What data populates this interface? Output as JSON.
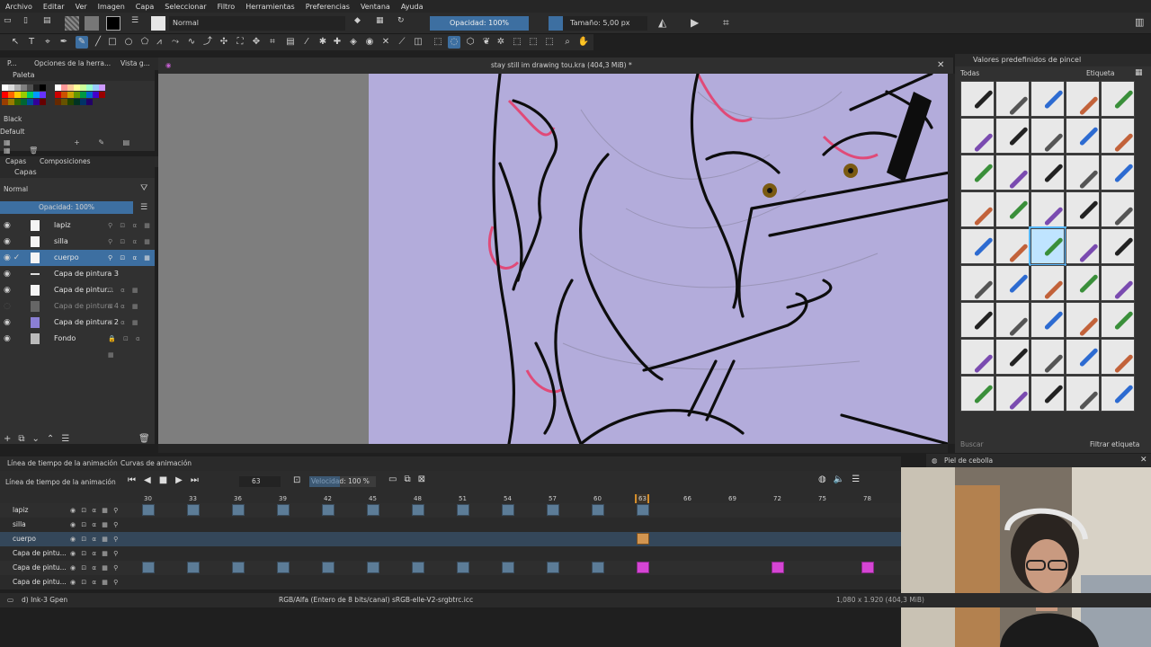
{
  "menu": [
    "Archivo",
    "Editar",
    "Ver",
    "Imagen",
    "Capa",
    "Seleccionar",
    "Filtro",
    "Herramientas",
    "Preferencias",
    "Ventana",
    "Ayuda"
  ],
  "tool_options": {
    "blend_mode": "Normal",
    "opacity": "Opacidad: 100%",
    "size": "Tamaño: 5,00 px"
  },
  "left_tabs": [
    "P...",
    "Opciones de la herra...",
    "Vista g..."
  ],
  "palette": {
    "title": "Paleta",
    "current_color": "Black",
    "preset": "Default",
    "colors": [
      "#ffffff",
      "#dcdcdc",
      "#b0b0b0",
      "#808080",
      "#505050",
      "#202020",
      "#000000",
      "#ffffff",
      "#ff9999",
      "#ffcc99",
      "#ffff99",
      "#ccff99",
      "#99ffcc",
      "#99ccff",
      "#cc99ff",
      "#ff0000",
      "#ff6600",
      "#ffcc00",
      "#99cc00",
      "#00cc66",
      "#0099ff",
      "#6633ff",
      "#cc0000",
      "#cc5200",
      "#cca300",
      "#669900",
      "#009944",
      "#0066cc",
      "#4400cc",
      "#990000",
      "#993d00",
      "#997a00",
      "#336600",
      "#006633",
      "#004c99",
      "#330099",
      "#660000",
      "#662900",
      "#665200",
      "#224400",
      "#003322",
      "#003366",
      "#220066"
    ]
  },
  "layers_panel": {
    "tabs": [
      "Capas",
      "Composiciones"
    ],
    "title": "Capas",
    "blend_mode": "Normal",
    "opacity": "Opacidad: 100%",
    "layers": [
      {
        "name": "lapiz",
        "dim": false
      },
      {
        "name": "silla",
        "dim": false
      },
      {
        "name": "cuerpo",
        "dim": false
      },
      {
        "name": "Capa de pintura 3",
        "dim": false
      },
      {
        "name": "Capa de pintur...",
        "dim": false
      },
      {
        "name": "Capa de pintura 4",
        "dim": true
      },
      {
        "name": "Capa de pintura 2",
        "dim": false
      },
      {
        "name": "Fondo",
        "dim": false
      }
    ]
  },
  "document": {
    "title": "stay still im drawing tou.kra (404,3 MiB) *"
  },
  "brush_presets": {
    "title": "Valores predefinidos de pincel",
    "filter_all": "Todas",
    "tag_label": "Etiqueta",
    "search_placeholder": "Buscar",
    "filter_tag": "Filtrar etiqueta"
  },
  "timeline": {
    "tabs": [
      "Línea de tiempo de la animación",
      "Curvas de animación"
    ],
    "title": "Línea de tiempo de la animación",
    "current_frame": "63",
    "speed": "Velocidad: 100 %",
    "ticks": [
      "30",
      "33",
      "36",
      "39",
      "42",
      "45",
      "48",
      "51",
      "54",
      "57",
      "60",
      "63",
      "66",
      "69",
      "72",
      "75",
      "78"
    ],
    "rows": [
      {
        "name": "lapiz"
      },
      {
        "name": "silla"
      },
      {
        "name": "cuerpo"
      },
      {
        "name": "Capa de pintu..."
      },
      {
        "name": "Capa de pintu..."
      },
      {
        "name": "Capa de pintu..."
      }
    ]
  },
  "onion_skin": {
    "title": "Piel de cebolla"
  },
  "status": {
    "brush": "d) Ink-3 Gpen",
    "color_space": "RGB/Alfa (Entero de 8 bits/canal)  sRGB-elle-V2-srgbtrc.icc",
    "dimensions": "1,080 x 1.920 (404,3 MiB)"
  },
  "colors": {
    "accent": "#3d6fa1",
    "canvas": "#b3acdb",
    "key": "#5c7c97",
    "key_pink": "#d545d4",
    "key_current": "#d29550"
  }
}
